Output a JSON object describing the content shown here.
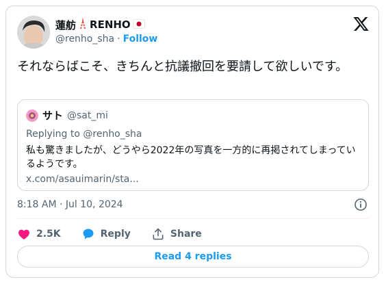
{
  "author": {
    "name": "蓮舫",
    "name_suffix": "RENHO",
    "handle": "@renho_sha",
    "separator": "·",
    "follow_label": "Follow"
  },
  "tweet": {
    "text": "それならばこそ、きちんと抗議撤回を要請して欲しいです。"
  },
  "quoted": {
    "name": "サト",
    "handle": "@sat_mi",
    "replying_to": "Replying to @renho_sha",
    "text": "私も驚きましたが、どうやら2022年の写真を一方的に再掲されてしまっているようです。",
    "link": "x.com/asauimarin/sta..."
  },
  "timestamp": "8:18 AM · Jul 10, 2024",
  "actions": {
    "like_count": "2.5K",
    "reply_label": "Reply",
    "share_label": "Share"
  },
  "read_replies_label": "Read 4 replies",
  "icons": {
    "tower": "tokyo-tower-emoji-icon",
    "flag": "japan-flag-emoji-icon",
    "logo": "x-logo-icon",
    "info": "info-icon",
    "like": "heart-icon",
    "reply": "speech-bubble-icon",
    "share": "share-upload-icon"
  },
  "colors": {
    "accent": "#1d9bf0",
    "like": "#f91880",
    "muted": "#536471",
    "border": "#cfd9de"
  }
}
